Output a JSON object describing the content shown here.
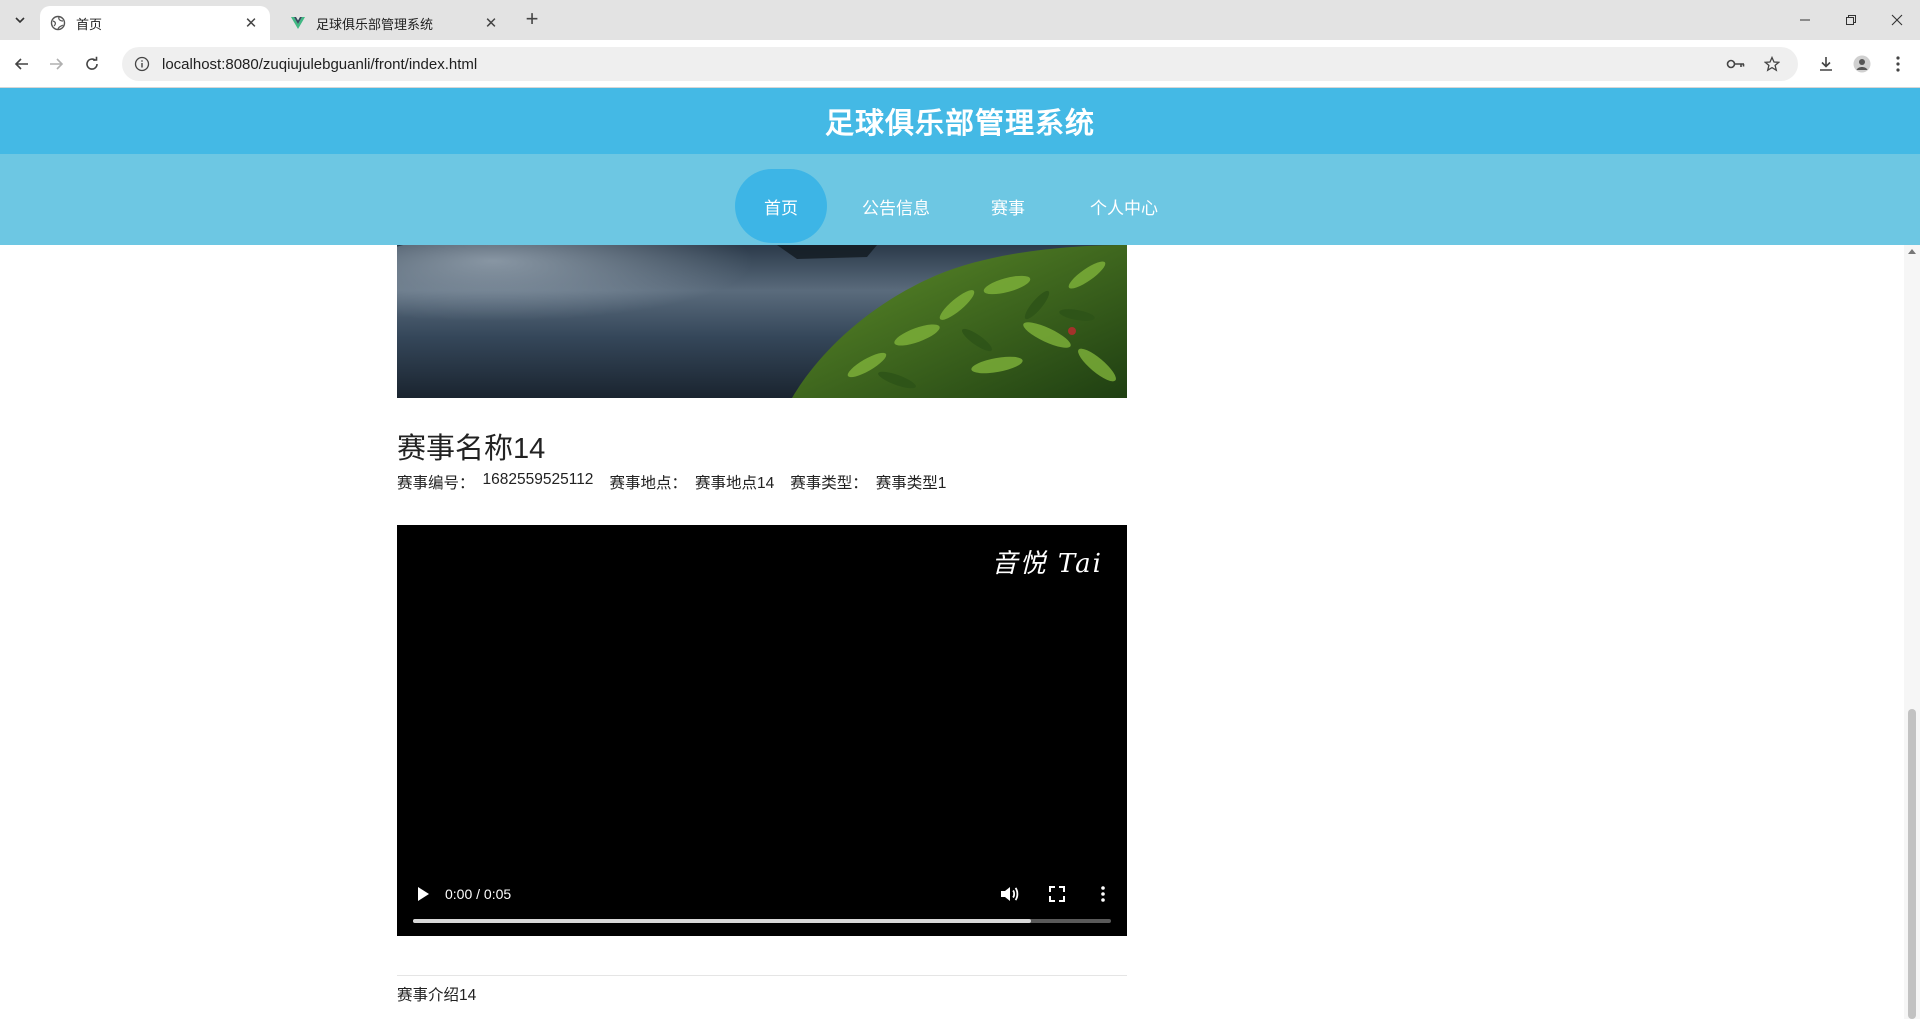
{
  "browser": {
    "tabs": [
      {
        "title": "首页",
        "icon": "globe-icon",
        "active": true
      },
      {
        "title": "足球俱乐部管理系统",
        "icon": "vue-icon",
        "active": false
      }
    ],
    "url": "localhost:8080/zuqiujulebguanli/front/index.html",
    "close_glyph": "✕",
    "new_tab_glyph": "+"
  },
  "site": {
    "title": "足球俱乐部管理系统",
    "nav": [
      {
        "label": "首页",
        "active": true
      },
      {
        "label": "公告信息",
        "active": false
      },
      {
        "label": "赛事",
        "active": false
      },
      {
        "label": "个人中心",
        "active": false
      }
    ]
  },
  "event": {
    "title": "赛事名称14",
    "meta": {
      "number_label": "赛事编号：",
      "number_value": "1682559525112",
      "location_label": "赛事地点：",
      "location_value": "赛事地点14",
      "type_label": "赛事类型：",
      "type_value": "赛事类型1"
    },
    "video": {
      "watermark": "音悦 Tai",
      "time": "0:00 / 0:05",
      "buffered_fraction": 0.886
    },
    "intro": "赛事介绍14"
  },
  "colors": {
    "header": "#44b9e5",
    "nav": "#6dc7e3",
    "nav_active": "#3db5e6"
  }
}
